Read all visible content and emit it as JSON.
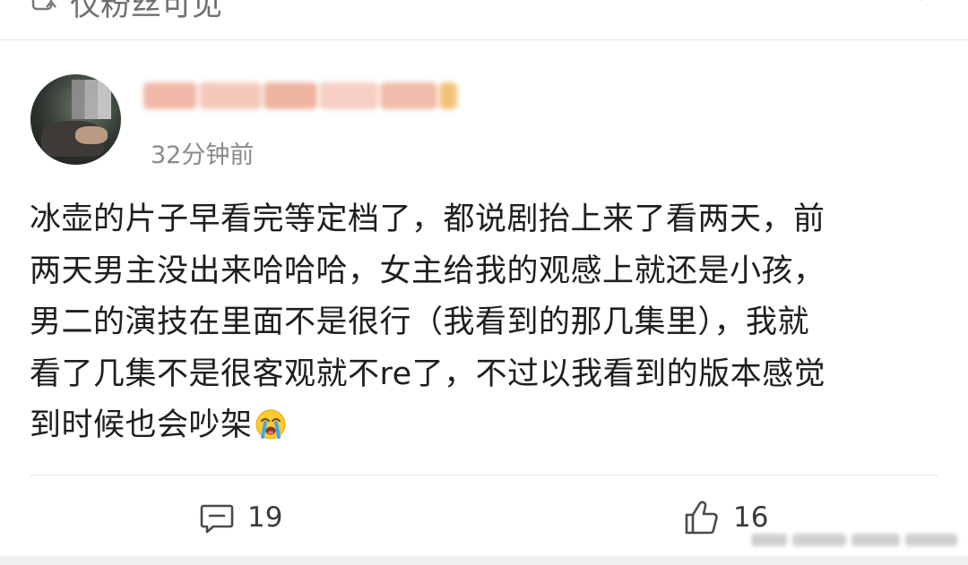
{
  "previous_post": {
    "visibility": "仅粉丝可见",
    "icons": [
      "lock-icon",
      "chevron-down-icon"
    ]
  },
  "post": {
    "author": {
      "avatar_icon": "avatar",
      "name_blurred": true
    },
    "timestamp": "32分钟前",
    "content_lines": [
      "冰壶的片子早看完等定档了，都说剧抬上来了看两天，前",
      "两天男主没出来哈哈哈，女主给我的观感上就还是小孩，",
      "男二的演技在里面不是很行（我看到的那几集里），我就",
      "看了几集不是很客观就不re了，不过以我看到的版本感觉",
      "到时候也会吵架"
    ],
    "trailing_emoji": "crying-face-emoji"
  },
  "actions": {
    "comment": {
      "icon": "comment-icon",
      "count": "19"
    },
    "like": {
      "icon": "thumbs-up-icon",
      "count": "16"
    }
  },
  "colors": {
    "text": "#1e1e1e",
    "muted": "#8a8a8a",
    "divider": "#e8e8e8",
    "background": "#ffffff"
  }
}
